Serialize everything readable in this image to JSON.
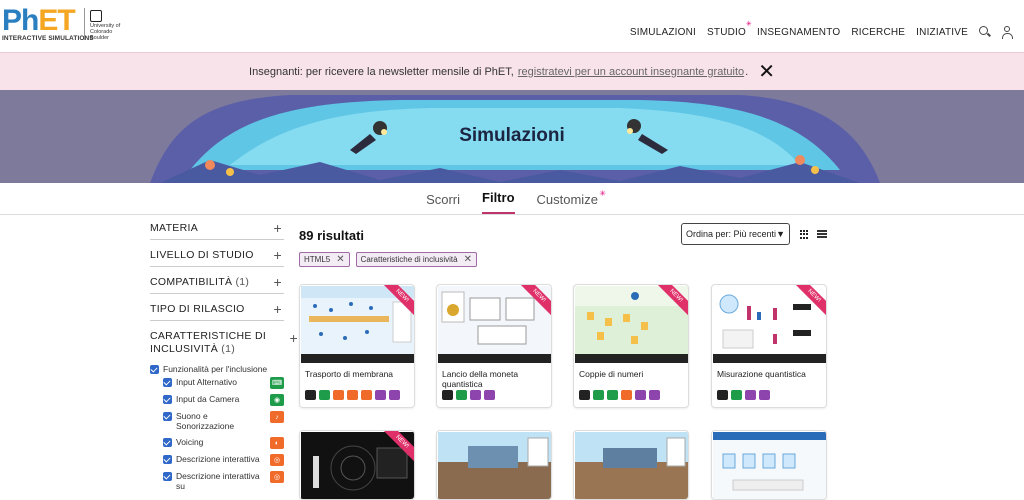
{
  "header": {
    "logo_main_ph": "Ph",
    "logo_main_et": "ET",
    "logo_sub": "INTERACTIVE SIMULATIONS",
    "cu_label": "University of Colorado Boulder",
    "nav": [
      "SIMULAZIONI",
      "STUDIO",
      "INSEGNAMENTO",
      "RICERCHE",
      "INIZIATIVE"
    ]
  },
  "notice": {
    "text_before": "Insegnanti: per ricevere la newsletter mensile di PhET,",
    "link": "registratevi per un account insegnante gratuito",
    "text_after": ".",
    "close": "✕"
  },
  "hero": {
    "title": "Simulazioni"
  },
  "tabs": [
    "Scorri",
    "Filtro",
    "Customize"
  ],
  "sidebar": {
    "filters": [
      {
        "label": "MATERIA",
        "count": ""
      },
      {
        "label": "LIVELLO DI STUDIO",
        "count": ""
      },
      {
        "label": "COMPATIBILITÀ",
        "count": "(1)"
      },
      {
        "label": "TIPO DI RILASCIO",
        "count": ""
      },
      {
        "label": "CARATTERISTICHE DI INCLUSIVITÀ",
        "count": "(1)"
      }
    ],
    "parent_option": "Funzionalità per l'inclusione",
    "options": [
      {
        "label": "Input Alternativo",
        "color": "#1f9c4a"
      },
      {
        "label": "Input da Camera",
        "color": "#1f9c4a"
      },
      {
        "label": "Suono e Sonorizzazione",
        "color": "#f06a2a"
      },
      {
        "label": "Voicing",
        "color": "#f06a2a"
      },
      {
        "label": "Descrizione interattiva",
        "color": "#f06a2a"
      },
      {
        "label": "Descrizione interattiva su",
        "color": "#f06a2a"
      }
    ]
  },
  "results": {
    "count_label": "89 risultati",
    "sort_label": "Ordina per: Più recenti",
    "chips": [
      "HTML5",
      "Caratteristiche di inclusività"
    ]
  },
  "cards": [
    {
      "title": "Trasporto di membrana",
      "ribbon": "NEW!",
      "icons": [
        "#222",
        "#1f9c4a",
        "#f06a2a",
        "#f06a2a",
        "#f06a2a",
        "#8e44ad",
        "#8e44ad"
      ]
    },
    {
      "title": "Lancio della moneta quantistica",
      "ribbon": "NEW!",
      "icons": [
        "#222",
        "#1f9c4a",
        "#8e44ad",
        "#8e44ad"
      ]
    },
    {
      "title": "Coppie di numeri",
      "ribbon": "NEW!",
      "icons": [
        "#222",
        "#1f9c4a",
        "#1f9c4a",
        "#f06a2a",
        "#8e44ad",
        "#8e44ad"
      ]
    },
    {
      "title": "Misurazione quantistica",
      "ribbon": "NEW!",
      "icons": [
        "#222",
        "#1f9c4a",
        "#8e44ad",
        "#8e44ad"
      ]
    }
  ]
}
